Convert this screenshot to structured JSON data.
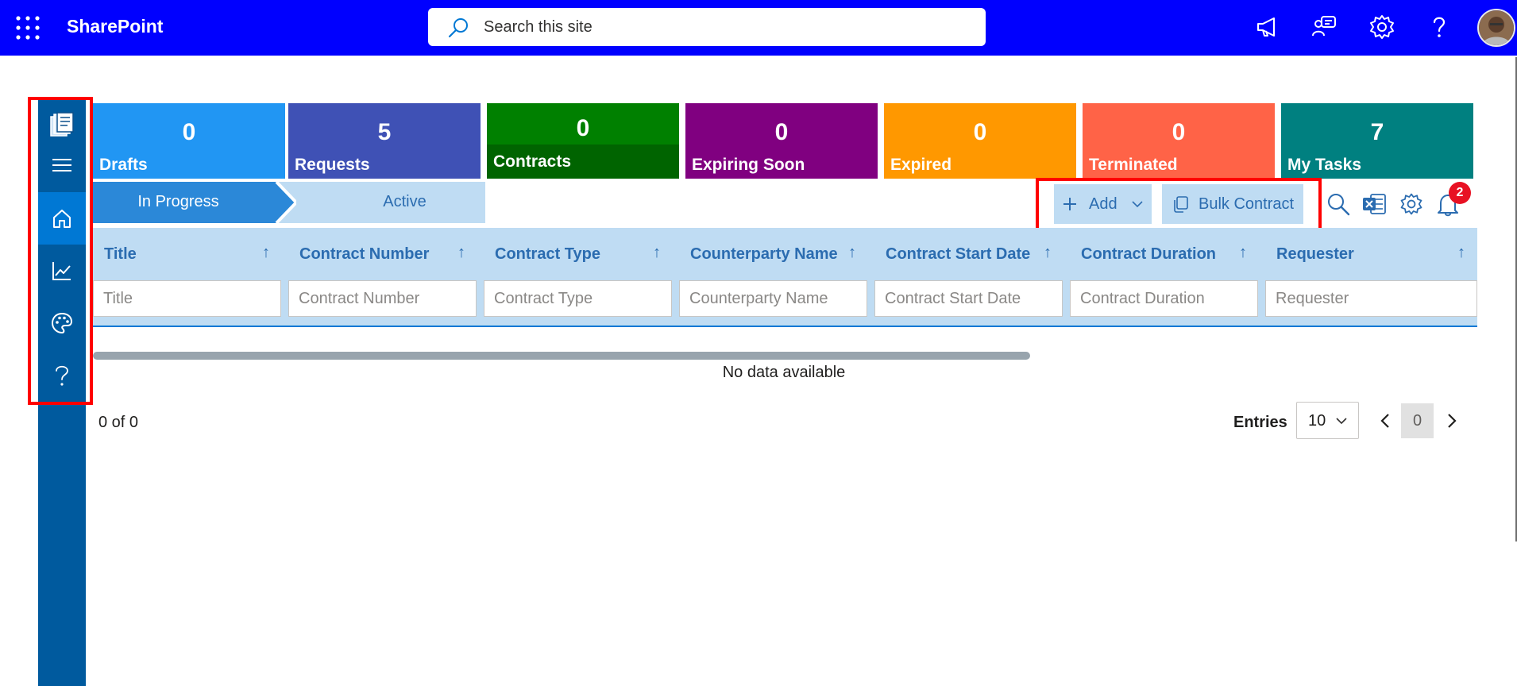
{
  "app": {
    "title": "SharePoint"
  },
  "search": {
    "placeholder": "Search this site"
  },
  "topbar": {
    "icons": [
      "waffle-icon",
      "megaphone-icon",
      "teams-chat-icon",
      "settings-icon",
      "help-icon"
    ],
    "color": "#0000ff"
  },
  "rail": {
    "items": [
      "documents-logo-icon",
      "hamburger-icon",
      "home-icon",
      "chart-icon",
      "palette-icon",
      "help-icon"
    ],
    "active": "home"
  },
  "tiles": [
    {
      "value": "0",
      "label": "Drafts",
      "color": "#2196f3"
    },
    {
      "value": "5",
      "label": "Requests",
      "color": "#3f51b5"
    },
    {
      "value": "0",
      "label": "Contracts",
      "color": "#008000"
    },
    {
      "value": "0",
      "label": "Expiring Soon",
      "color": "#800080"
    },
    {
      "value": "0",
      "label": "Expired",
      "color": "#ff9800"
    },
    {
      "value": "0",
      "label": "Terminated",
      "color": "#ff6347"
    },
    {
      "value": "7",
      "label": "My Tasks",
      "color": "#008080"
    }
  ],
  "tabs": {
    "in_progress": "In Progress",
    "active": "Active"
  },
  "toolbar": {
    "add_label": "Add",
    "bulk_label": "Bulk Contract",
    "notification_count": "2"
  },
  "grid": {
    "columns": [
      {
        "title": "Title",
        "filter_placeholder": "Title"
      },
      {
        "title": "Contract Number",
        "filter_placeholder": "Contract Number"
      },
      {
        "title": "Contract Type",
        "filter_placeholder": "Contract Type"
      },
      {
        "title": "Counterparty Name",
        "filter_placeholder": "Counterparty Name"
      },
      {
        "title": "Contract Start Date",
        "filter_placeholder": "Contract Start Date"
      },
      {
        "title": "Contract Duration",
        "filter_placeholder": "Contract Duration"
      },
      {
        "title": "Requester",
        "filter_placeholder": "Requester"
      }
    ],
    "sort_glyph": "↑",
    "empty_text": "No data available"
  },
  "pagination": {
    "count_text": "0 of 0",
    "entries_label": "Entries",
    "entries_value": "10",
    "current_page": "0"
  }
}
